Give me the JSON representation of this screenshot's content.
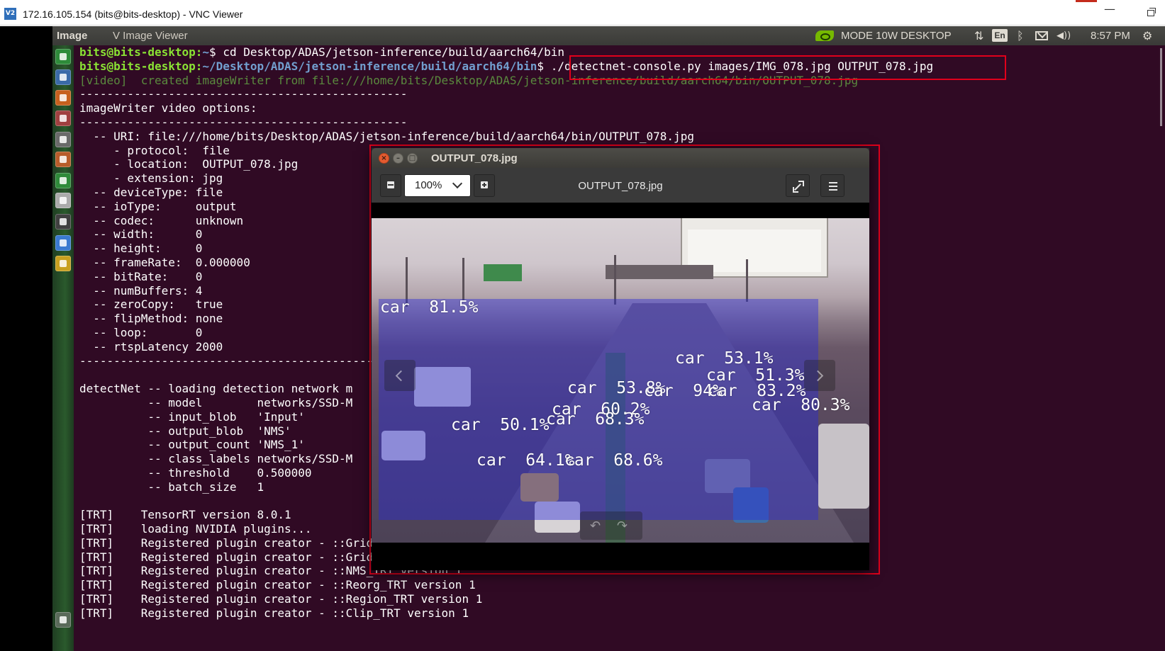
{
  "vnc": {
    "title": "172.16.105.154 (bits@bits-desktop) - VNC Viewer",
    "logo_text": "V2",
    "minimize_glyph": "—"
  },
  "top_panel": {
    "app_name": "Image",
    "app_menu": "V Image Viewer",
    "power_mode": "MODE 10W DESKTOP",
    "network_icon": "⇅",
    "language": "En",
    "bluetooth_icon": "ᛒ",
    "volume_icon": "◀))",
    "time": "8:57 PM",
    "settings_icon": "⚙"
  },
  "launcher": {
    "icons": [
      {
        "name": "system-settings-icon",
        "color": "#2e8b3a"
      },
      {
        "name": "files-icon",
        "color": "#3a6aa8"
      },
      {
        "name": "text-editor-icon",
        "color": "#c7601e"
      },
      {
        "name": "tools-icon",
        "color": "#a04040"
      },
      {
        "name": "disks-icon",
        "color": "#6a6a6a"
      },
      {
        "name": "archive-icon",
        "color": "#b85c2a"
      },
      {
        "name": "spreadsheet-icon",
        "color": "#2f8a3a"
      },
      {
        "name": "document-icon",
        "color": "#ababab"
      },
      {
        "name": "terminal-icon",
        "color": "#404040"
      },
      {
        "name": "browser-icon",
        "color": "#3a7ad0"
      },
      {
        "name": "photos-icon",
        "color": "#c8a020"
      },
      {
        "name": "trash-icon",
        "color": "#5a6a5a"
      }
    ]
  },
  "terminal": {
    "lines": [
      {
        "type": "cmd",
        "user": "bits@bits-desktop",
        "path": "~",
        "cmd": " cd Desktop/ADAS/jetson-inference/build/aarch64/bin"
      },
      {
        "type": "cmd",
        "user": "bits@bits-desktop",
        "path": "~/Desktop/ADAS/jetson-inference/build/aarch64/bin",
        "cmd": " ./detectnet-console.py images/IMG_078.jpg OUTPUT_078.jpg"
      },
      {
        "type": "dim",
        "text": "[video]  created imageWriter from file:///home/bits/Desktop/ADAS/jetson-inference/build/aarch64/bin/OUTPUT_078.jpg"
      },
      {
        "type": "text",
        "text": "------------------------------------------------"
      },
      {
        "type": "text",
        "text": "imageWriter video options:"
      },
      {
        "type": "text",
        "text": "------------------------------------------------"
      },
      {
        "type": "text",
        "text": "  -- URI: file:///home/bits/Desktop/ADAS/jetson-inference/build/aarch64/bin/OUTPUT_078.jpg"
      },
      {
        "type": "text",
        "text": "     - protocol:  file"
      },
      {
        "type": "text",
        "text": "     - location:  OUTPUT_078.jpg"
      },
      {
        "type": "text",
        "text": "     - extension: jpg"
      },
      {
        "type": "text",
        "text": "  -- deviceType: file"
      },
      {
        "type": "text",
        "text": "  -- ioType:     output"
      },
      {
        "type": "text",
        "text": "  -- codec:      unknown"
      },
      {
        "type": "text",
        "text": "  -- width:      0"
      },
      {
        "type": "text",
        "text": "  -- height:     0"
      },
      {
        "type": "text",
        "text": "  -- frameRate:  0.000000"
      },
      {
        "type": "text",
        "text": "  -- bitRate:    0"
      },
      {
        "type": "text",
        "text": "  -- numBuffers: 4"
      },
      {
        "type": "text",
        "text": "  -- zeroCopy:   true"
      },
      {
        "type": "text",
        "text": "  -- flipMethod: none"
      },
      {
        "type": "text",
        "text": "  -- loop:       0"
      },
      {
        "type": "text",
        "text": "  -- rtspLatency 2000"
      },
      {
        "type": "text",
        "text": "------------------------------------------------"
      },
      {
        "type": "text",
        "text": ""
      },
      {
        "type": "text",
        "text": "detectNet -- loading detection network m"
      },
      {
        "type": "text",
        "text": "          -- model        networks/SSD-M"
      },
      {
        "type": "text",
        "text": "          -- input_blob   'Input'"
      },
      {
        "type": "text",
        "text": "          -- output_blob  'NMS'"
      },
      {
        "type": "text",
        "text": "          -- output_count 'NMS_1'"
      },
      {
        "type": "text",
        "text": "          -- class_labels networks/SSD-M"
      },
      {
        "type": "text",
        "text": "          -- threshold    0.500000"
      },
      {
        "type": "text",
        "text": "          -- batch_size   1"
      },
      {
        "type": "text",
        "text": ""
      },
      {
        "type": "text",
        "text": "[TRT]    TensorRT version 8.0.1"
      },
      {
        "type": "text",
        "text": "[TRT]    loading NVIDIA plugins..."
      },
      {
        "type": "text",
        "text": "[TRT]    Registered plugin creator - ::GridAnchor_TRT version 1"
      },
      {
        "type": "text",
        "text": "[TRT]    Registered plugin creator - ::GridAnchorRect_TRT version 1"
      },
      {
        "type": "text",
        "text": "[TRT]    Registered plugin creator - ::NMS_TRT version 1"
      },
      {
        "type": "text",
        "text": "[TRT]    Registered plugin creator - ::Reorg_TRT version 1"
      },
      {
        "type": "text",
        "text": "[TRT]    Registered plugin creator - ::Region_TRT version 1"
      },
      {
        "type": "text",
        "text": "[TRT]    Registered plugin creator - ::Clip_TRT version 1"
      }
    ]
  },
  "viewer": {
    "window_title": "OUTPUT_078.jpg",
    "close_glyph": "×",
    "min_glyph": "–",
    "max_glyph": "□",
    "zoom": "100%",
    "filename": "OUTPUT_078.jpg",
    "rotate_left": "↶",
    "rotate_right": "↷",
    "detections": [
      {
        "text": "car  81.5%"
      },
      {
        "text": "car  53.1%"
      },
      {
        "text": "car  51.3%"
      },
      {
        "text": "car  53.8%"
      },
      {
        "text": "car  94%"
      },
      {
        "text": "car  83.2%"
      },
      {
        "text": "car  80.3%"
      },
      {
        "text": "car  60.2%"
      },
      {
        "text": "car  50.1%"
      },
      {
        "text": "car  68.3%"
      },
      {
        "text": "car  64.1%"
      },
      {
        "text": "car  68.6%"
      }
    ]
  }
}
